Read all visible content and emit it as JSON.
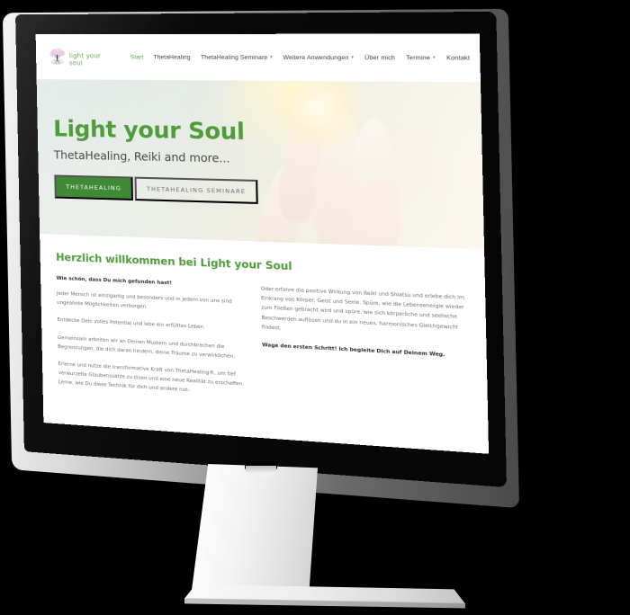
{
  "device": {
    "type": "desktop-monitor-mockup",
    "frame_color": "#c9c9c9",
    "bezel_color": "#0a0a0a",
    "stand_color": "#f0f0f0",
    "background_color": "#000000"
  },
  "site": {
    "brand": {
      "logo_icon": "tree-logo-icon",
      "wordmark": "light your soul",
      "wordmark_color": "#6aa84f"
    },
    "nav": {
      "items": [
        {
          "label": "Start",
          "active": true,
          "has_dropdown": false
        },
        {
          "label": "ThetaHealing",
          "active": false,
          "has_dropdown": false
        },
        {
          "label": "ThetaHealing Seminare",
          "active": false,
          "has_dropdown": true
        },
        {
          "label": "Weitere Anwendungen",
          "active": false,
          "has_dropdown": true
        },
        {
          "label": "Über mich",
          "active": false,
          "has_dropdown": false
        },
        {
          "label": "Termine",
          "active": false,
          "has_dropdown": true
        },
        {
          "label": "Kontakt",
          "active": false,
          "has_dropdown": false
        }
      ],
      "dropdown_caret": "▾"
    },
    "hero": {
      "title": "Light your Soul",
      "title_color": "#4f9c3a",
      "subtitle": "ThetaHealing, Reiki and more...",
      "primary_button": "THETAHEALING",
      "primary_button_color": "#3f8a34",
      "secondary_button": "THETAHEALING SEMINARE",
      "background_image": "glowing-hand-photo"
    },
    "main": {
      "heading": "Herzlich willkommen bei Light your Soul",
      "heading_color": "#4f9c3a",
      "left_column": {
        "lead": "Wie schön, dass Du mich gefunden hast!",
        "paragraphs": [
          "Jeder Mensch ist einzigartig und besonders und in jedem von uns sind ungeahnte Möglichkeiten verborgen.",
          "Entdecke Dein volles Potential und lebe ein erfülltes Leben.",
          "Gemeinsam arbeiten wir an Deinen Mustern und durchbrechen die Begrenzungen, die dich daran hindern, deine Träume zu verwirklichen.",
          "Erlerne und nutze die transformative Kraft von ThetaHealing®, um tief verwurzelte Glaubenssätze zu lösen und eine neue Realität zu erschaffen. Lerne, wie Du diese Technik für dich und andere nut-"
        ]
      },
      "right_column": {
        "paragraphs": [
          "Oder erfahre die positive Wirkung von Reiki und Shiatsu und erlebe dich im Einklang von Körper, Geist und Seele. Spüre, wie die Lebensenergie wieder zum Fließen gebracht wird und spüre, wie sich körperliche und seelische Beschwerden auflösen und du in ein neues, harmonisches Gleichgewicht findest."
        ],
        "closing": "Wage den ersten Schritt! Ich begleite Dich auf Deinem Weg."
      }
    }
  }
}
